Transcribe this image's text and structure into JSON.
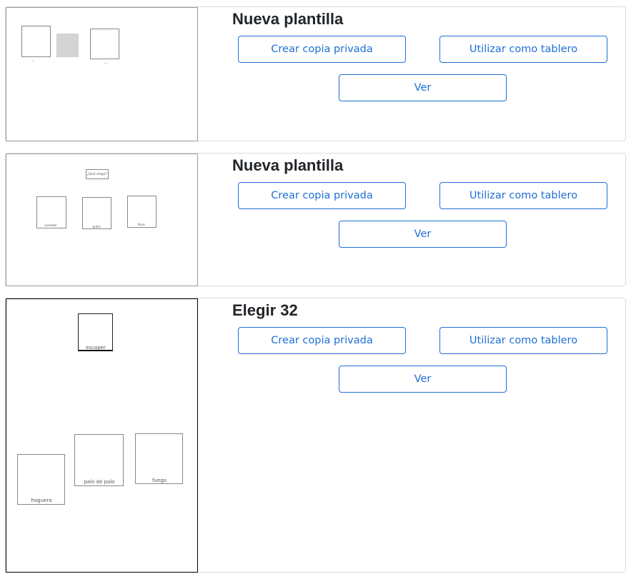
{
  "buttons": {
    "copy": "Crear copia privada",
    "board": "Utilizar como tablero",
    "view": "Ver"
  },
  "templates": [
    {
      "title": "Nueva plantilla",
      "thumbnail": {
        "captions": [
          "—",
          "",
          "—"
        ]
      }
    },
    {
      "title": "Nueva plantilla",
      "thumbnail": {
        "header": "¿Qué elegir?",
        "captions": [
          "comedor",
          "gritar",
          "llorar"
        ]
      }
    },
    {
      "title": "Elegir 32",
      "thumbnail": {
        "captions": [
          "escaper",
          "hoguera",
          "palo de palo",
          "fuego"
        ]
      }
    }
  ],
  "colors": {
    "accent": "#1e6fd6",
    "title": "#212529",
    "card_border": "#dcdcdc"
  }
}
